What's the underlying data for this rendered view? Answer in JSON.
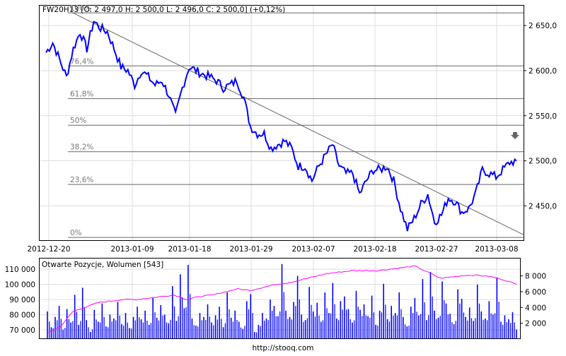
{
  "chart_data": [
    {
      "type": "line",
      "title": "FW20H13 [O: 2 497,0  H: 2 500,0  L: 2 496,0  C: 2 500,0] (+0,12%)",
      "x_tick_labels": [
        "2012-12-20",
        "2013-01-09",
        "2013-01-18",
        "2013-01-29",
        "2013-02-07",
        "2013-02-18",
        "2013-02-27",
        "2013-03-08"
      ],
      "y_tick_labels": [
        "2 650,0",
        "2 600,0",
        "2 550,0",
        "2 500,0",
        "2 450,0"
      ],
      "y_ticks": [
        2650,
        2600,
        2550,
        2500,
        2450
      ],
      "ylim": [
        2412,
        2672
      ],
      "grid": true,
      "series_color": "#0000ff",
      "values": [
        2620,
        2631,
        2612,
        2593,
        2624,
        2643,
        2624,
        2655,
        2647,
        2643,
        2624,
        2604,
        2600,
        2584,
        2600,
        2593,
        2584,
        2589,
        2573,
        2550,
        2581,
        2604,
        2600,
        2596,
        2593,
        2589,
        2581,
        2584,
        2589,
        2570,
        2538,
        2530,
        2530,
        2514,
        2518,
        2522,
        2514,
        2494,
        2494,
        2478,
        2494,
        2506,
        2518,
        2494,
        2486,
        2486,
        2463,
        2478,
        2490,
        2490,
        2494,
        2478,
        2447,
        2424,
        2436,
        2452,
        2463,
        2432,
        2440,
        2459,
        2455,
        2443,
        2447,
        2463,
        2490,
        2486,
        2482,
        2490,
        2498,
        2500
      ],
      "fibonacci": {
        "high": 2664,
        "low": 2415,
        "levels": [
          {
            "label": "0%",
            "pct": 0
          },
          {
            "label": "23,6%",
            "pct": 23.6
          },
          {
            "label": "38,2%",
            "pct": 38.2
          },
          {
            "label": "50%",
            "pct": 50
          },
          {
            "label": "61,8%",
            "pct": 61.8
          },
          {
            "label": "76,4%",
            "pct": 76.4
          },
          {
            "label": "100%",
            "pct": 100
          }
        ]
      },
      "trendline": {
        "start": 2664,
        "end": 2418
      }
    },
    {
      "type": "bar",
      "title": "Otwarte Pozycje, Wolumen [543]",
      "left_tick_labels": [
        "110 000",
        "100 000",
        "90 000",
        "80 000",
        "70 000"
      ],
      "left_ticks": [
        110000,
        100000,
        90000,
        80000,
        70000
      ],
      "left_ylim": [
        64000,
        117000
      ],
      "right_tick_labels": [
        "8 000",
        "6 000",
        "4 000",
        "2 000"
      ],
      "right_ticks": [
        8000,
        6000,
        4000,
        2000
      ],
      "right_ylim": [
        0,
        10200
      ],
      "volume_color": "#0000ff",
      "open_interest_color": "#ff00ff",
      "volume": [
        3500,
        1500,
        2800,
        4200,
        1200,
        3800,
        2100,
        5600,
        1800,
        6500,
        2400,
        900,
        3700,
        2200,
        4500,
        1600,
        3100,
        2600,
        4700,
        1900,
        3300,
        1400,
        2800,
        4100,
        2500,
        3600,
        1800,
        5200,
        2700,
        4300,
        3100,
        2000,
        6700,
        2300,
        8200,
        3900,
        9400,
        2600,
        1700,
        3300,
        2800,
        4400,
        2100,
        3000,
        4100,
        1500,
        5900,
        2700,
        3600,
        2200,
        1300,
        4800,
        5700,
        900,
        1800,
        3300,
        2600,
        5000,
        4200,
        2900,
        9500,
        3600,
        2800,
        4700,
        8000,
        3100,
        2400,
        6600,
        3500,
        4600,
        2200,
        5900,
        3300,
        7100,
        2600,
        4800,
        5400,
        3800,
        2100,
        6100,
        3700,
        4400,
        2900,
        5500,
        1800,
        3600,
        7000,
        2500,
        4200,
        3300,
        5900,
        2800,
        1600,
        4100,
        5200,
        3000,
        7600,
        2400,
        8500,
        3600,
        2700,
        7300,
        4500,
        3200,
        1900,
        6300,
        5100,
        2800,
        4000,
        2300,
        6900,
        3500,
        2600,
        4800,
        3100,
        7800,
        2200,
        3000,
        2500,
        3400,
        1200
      ],
      "open_interest": [
        68000,
        72000,
        82000,
        85000,
        88000,
        89000,
        90000,
        90000,
        91000,
        92000,
        93000,
        90000,
        92000,
        93000,
        95000,
        97000,
        96000,
        98000,
        100000,
        101000,
        103000,
        105000,
        107000,
        108000,
        109000,
        109000,
        109000,
        110000,
        111000,
        112000,
        108000,
        104000,
        105000,
        106000,
        106000,
        105000,
        103000,
        100000
      ]
    }
  ],
  "footer": {
    "url": "http://stooq.com"
  }
}
